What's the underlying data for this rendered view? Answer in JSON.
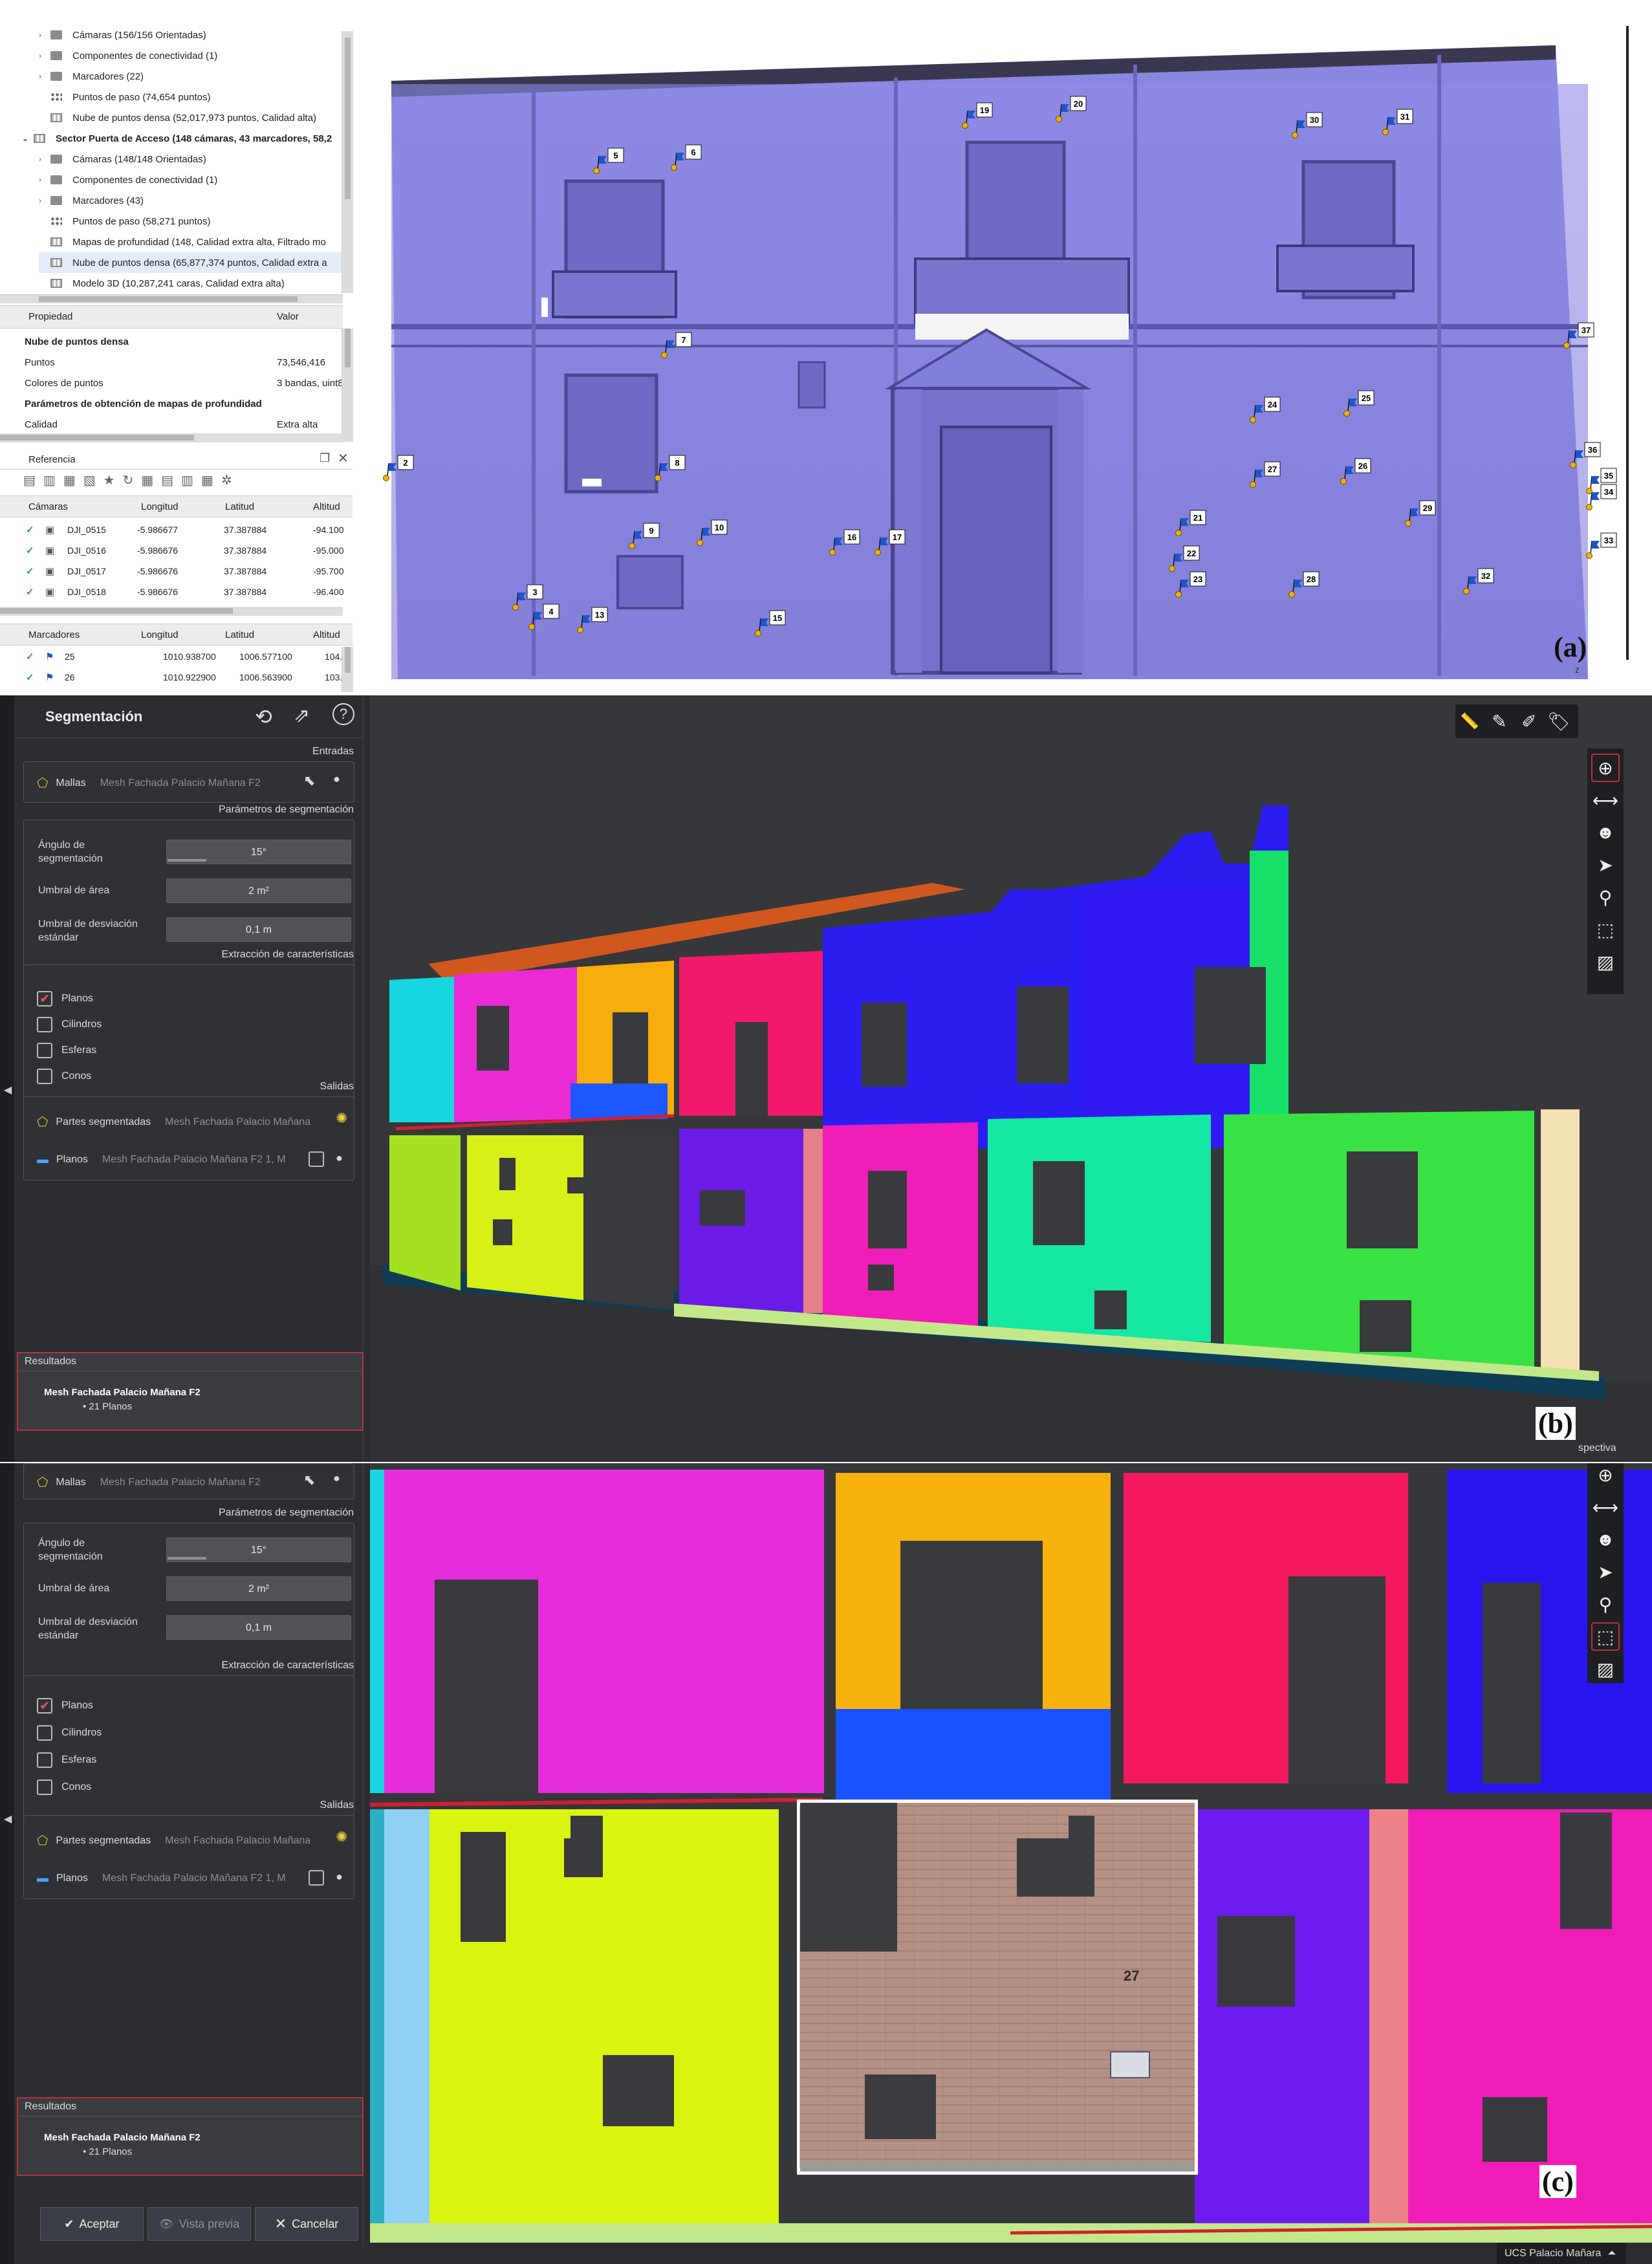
{
  "panel_a": {
    "label": "(a)",
    "tree": [
      {
        "indent": 1,
        "icon": "folder",
        "label": "Cámaras (156/156 Orientadas)"
      },
      {
        "indent": 1,
        "icon": "folder",
        "label": "Componentes de conectividad (1)"
      },
      {
        "indent": 1,
        "icon": "folder",
        "label": "Marcadores (22)"
      },
      {
        "indent": 1,
        "icon": "dots",
        "label": "Puntos de paso (74,654 puntos)"
      },
      {
        "indent": 1,
        "icon": "grid",
        "label": "Nube de puntos densa (52,017,973 puntos, Calidad alta)"
      },
      {
        "indent": 0,
        "icon": "grid",
        "label": "Sector Puerta de Acceso (148 cámaras, 43 marcadores, 58,2",
        "bold": true
      },
      {
        "indent": 1,
        "icon": "folder",
        "label": "Cámaras (148/148 Orientadas)"
      },
      {
        "indent": 1,
        "icon": "folder",
        "label": "Componentes de conectividad (1)"
      },
      {
        "indent": 1,
        "icon": "folder",
        "label": "Marcadores (43)"
      },
      {
        "indent": 1,
        "icon": "dots",
        "label": "Puntos de paso (58,271 puntos)"
      },
      {
        "indent": 1,
        "icon": "grid",
        "label": "Mapas de profundidad (148, Calidad extra alta, Filtrado mo"
      },
      {
        "indent": 1,
        "icon": "grid",
        "label": "Nube de puntos densa (65,877,374 puntos, Calidad extra a",
        "selected": true
      },
      {
        "indent": 1,
        "icon": "grid",
        "label": "Modelo 3D (10,287,241 caras, Calidad extra alta)"
      }
    ],
    "properties": {
      "header_prop": "Propiedad",
      "header_val": "Valor",
      "rows": [
        {
          "prop": "Nube de puntos densa",
          "val": "",
          "bold": true
        },
        {
          "prop": "Puntos",
          "val": "73,546,416"
        },
        {
          "prop": "Colores de puntos",
          "val": "3 bandas, uint8"
        },
        {
          "prop": "Parámetros de obtención de mapas de profundidad",
          "val": "",
          "bold": true
        },
        {
          "prop": "Calidad",
          "val": "Extra alta"
        }
      ]
    },
    "reference": {
      "title": "Referencia",
      "camera_headers": [
        "Cámaras",
        "Longitud",
        "Latitud",
        "Altitud"
      ],
      "cameras": [
        [
          "DJI_0515",
          "-5.986677",
          "37.387884",
          "-94.100"
        ],
        [
          "DJI_0516",
          "-5.986676",
          "37.387884",
          "-95.000"
        ],
        [
          "DJI_0517",
          "-5.986676",
          "37.387884",
          "-95.700"
        ],
        [
          "DJI_0518",
          "-5.986676",
          "37.387884",
          "-96.400"
        ]
      ],
      "marker_headers": [
        "Marcadores",
        "Longitud",
        "Latitud",
        "Altitud"
      ],
      "markers": [
        [
          "25",
          "1010.938700",
          "1006.577100",
          "104."
        ],
        [
          "26",
          "1010.922900",
          "1006.563900",
          "103."
        ]
      ]
    },
    "facade_color": "#8b87e0",
    "markers_on_facade": [
      "2",
      "3",
      "4",
      "5",
      "6",
      "7",
      "8",
      "9",
      "10",
      "13",
      "15",
      "16",
      "17",
      "19",
      "20",
      "21",
      "22",
      "23",
      "24",
      "25",
      "26",
      "27",
      "28",
      "29",
      "30",
      "31",
      "32",
      "33",
      "34",
      "35",
      "36",
      "37"
    ]
  },
  "panel_b": {
    "label": "(b)",
    "title": "Segmentación",
    "inputs_title": "Entradas",
    "mesh_label": "Mallas",
    "mesh_value": "Mesh Fachada Palacio Mañana F2",
    "params_title": "Parámetros de segmentación",
    "angle_label": "Ángulo de segmentación",
    "angle_value": "15°",
    "area_label": "Umbral de área",
    "area_value": "2 m²",
    "std_label": "Umbral de desviación estándar",
    "std_value": "0,1 m",
    "extract_title": "Extracción de características",
    "features": [
      {
        "label": "Planos",
        "checked": true
      },
      {
        "label": "Cilindros",
        "checked": false
      },
      {
        "label": "Esferas",
        "checked": false
      },
      {
        "label": "Conos",
        "checked": false
      }
    ],
    "outputs_title": "Salidas",
    "out_parts_label": "Partes segmentadas",
    "out_parts_value": "Mesh Fachada Palacio Mañana",
    "out_planes_label": "Planos",
    "out_planes_value": "Mesh Fachada Palacio Mañana F2 1, M",
    "results_title": "Resultados",
    "results_name": "Mesh Fachada Palacio Mañana F2",
    "results_count": "• 21 Planos",
    "view_mode": "spectiva"
  },
  "panel_c": {
    "label": "(c)",
    "accept": "Aceptar",
    "preview": "Vista previa",
    "cancel": "Cancelar",
    "ucs": "UCS Palacio Mañara",
    "house_number": "27"
  }
}
